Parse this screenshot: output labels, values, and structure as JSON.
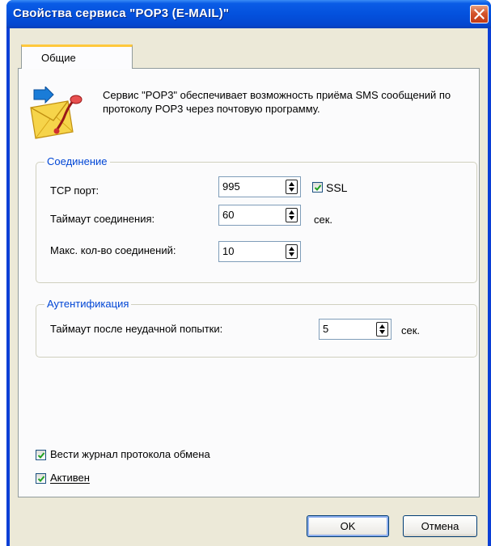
{
  "window": {
    "title": "Свойства сервиса \"POP3 (E-MAIL)\""
  },
  "tabs": [
    {
      "label": "Общие"
    }
  ],
  "description": "Сервис \"POP3\" обеспечивает возможность приёма SMS сообщений по протоколу POP3 через почтовую программу.",
  "connection": {
    "title": "Соединение",
    "tcp_port_label": "TCP порт:",
    "tcp_port_value": "995",
    "ssl_label": "SSL",
    "ssl_checked": true,
    "timeout_label": "Таймаут соединения:",
    "timeout_value": "60",
    "timeout_unit": "сек.",
    "max_conn_label": "Макс. кол-во соединений:",
    "max_conn_value": "10"
  },
  "auth": {
    "title": "Аутентификация",
    "fail_timeout_label": "Таймаут после неудачной попытки:",
    "fail_timeout_value": "5",
    "fail_timeout_unit": "сек."
  },
  "options": {
    "log_label": "Вести журнал протокола обмена",
    "log_checked": true,
    "active_label": "Активен",
    "active_checked": true
  },
  "buttons": {
    "ok": "OK",
    "cancel": "Отмена"
  },
  "colors": {
    "titlebar": "#0451dd",
    "group_title": "#0046d5",
    "tab_accent": "#ffc83c",
    "face": "#ece9d8"
  },
  "icons": {
    "service": "mail-envelope-icon",
    "close": "close-icon",
    "spin": "spin-arrows-icon",
    "check": "checkmark-icon"
  }
}
